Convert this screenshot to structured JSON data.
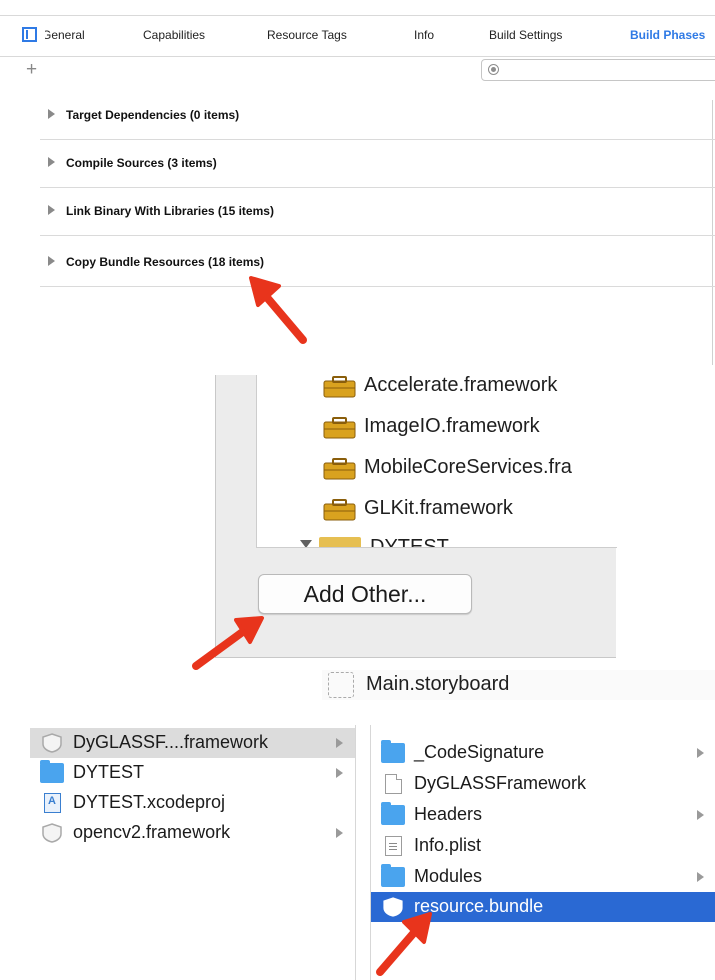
{
  "build_phases": {
    "tabs": [
      "General",
      "Capabilities",
      "Resource Tags",
      "Info",
      "Build Settings",
      "Build Phases"
    ],
    "active_tab": "Build Phases",
    "add_symbol": "+",
    "phases": [
      "Target Dependencies (0 items)",
      "Compile Sources (3 items)",
      "Link Binary With Libraries (15 items)",
      "Copy Bundle Resources (18 items)"
    ]
  },
  "add_dialog": {
    "frameworks": [
      "Accelerate.framework",
      "ImageIO.framework",
      "MobileCoreServices.fra",
      "GLKit.framework"
    ],
    "group_partial": "DYTEST",
    "add_other_label": "Add Other...",
    "storyboard_label": "Main.storyboard"
  },
  "finder": {
    "left_column": [
      {
        "name": "DyGLASSF....framework",
        "icon": "framework-icon",
        "has_children": true,
        "selected": true
      },
      {
        "name": "DYTEST",
        "icon": "folder-icon",
        "has_children": true,
        "selected": false
      },
      {
        "name": "DYTEST.xcodeproj",
        "icon": "xcodeproj-icon",
        "has_children": false,
        "selected": false
      },
      {
        "name": "opencv2.framework",
        "icon": "framework-icon",
        "has_children": true,
        "selected": false
      }
    ],
    "right_column": [
      {
        "name": "_CodeSignature",
        "icon": "folder-icon",
        "has_children": true,
        "selected": false
      },
      {
        "name": "DyGLASSFramework",
        "icon": "file-icon",
        "has_children": false,
        "selected": false
      },
      {
        "name": "Headers",
        "icon": "folder-icon",
        "has_children": true,
        "selected": false
      },
      {
        "name": "Info.plist",
        "icon": "plist-icon",
        "has_children": false,
        "selected": false
      },
      {
        "name": "Modules",
        "icon": "folder-icon",
        "has_children": true,
        "selected": false
      },
      {
        "name": "resource.bundle",
        "icon": "bundle-icon",
        "has_children": false,
        "selected": true
      }
    ]
  },
  "colors": {
    "accent_blue": "#2f7ae5",
    "selection_blue": "#2a69d3",
    "annotation_red": "#e8341c",
    "toolbox_orange": "#d9a21f"
  }
}
